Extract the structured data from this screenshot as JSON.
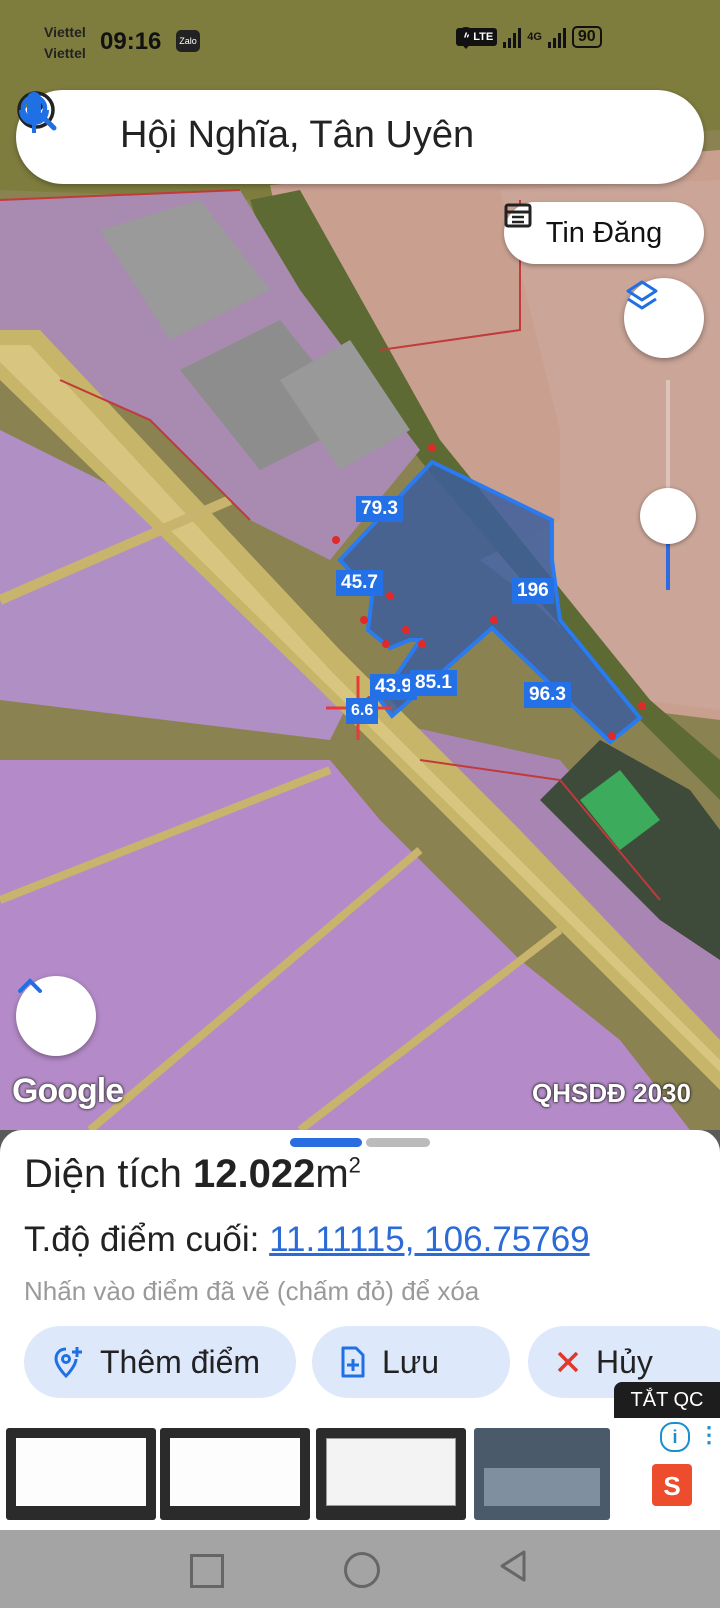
{
  "status_bar": {
    "carrier_line1": "Viettel",
    "carrier_line2": "Viettel",
    "time": "09:16",
    "zalo_badge": "Zalo",
    "volte": "VoLTE",
    "network": "4G",
    "battery": "90"
  },
  "search": {
    "query": "Hội Nghĩa, Tân Uyên"
  },
  "map": {
    "chip_label": "Tin Đăng",
    "watermark": "Google",
    "layer_label": "QHSDĐ 2030",
    "measurements": [
      "79.3",
      "45.7",
      "196",
      "43.9",
      "85.1",
      "96.3",
      "6.6"
    ]
  },
  "sheet": {
    "area_label": "Diện tích",
    "area_value": "12.022",
    "area_unit": "m",
    "area_exp": "2",
    "coord_label": "T.độ điểm cuối:",
    "coord_value": "11.11115, 106.75769",
    "hint": "Nhấn vào điểm đã vẽ (chấm đỏ) để xóa",
    "buttons": {
      "add": "Thêm điểm",
      "save": "Lưu",
      "cancel": "Hủy"
    }
  },
  "ad": {
    "close_label": "TẮT QC"
  },
  "colors": {
    "accent": "#2470e6",
    "button_bg": "#dde8fb",
    "parcel_fill": "#3d5e9c",
    "zone_purple": "#b48bc8"
  },
  "icons": [
    "account-circle-icon",
    "search-icon",
    "mic-icon",
    "calendar-list-icon",
    "layers-icon",
    "chevron-up-icon",
    "add-location-icon",
    "save-file-icon",
    "close-icon",
    "info-icon",
    "shopee-bag-icon"
  ]
}
